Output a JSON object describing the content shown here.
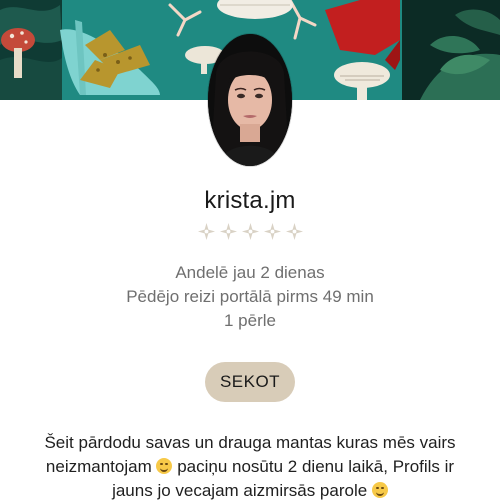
{
  "profile": {
    "username": "krista.jm",
    "rating": {
      "filled": 0,
      "max": 5,
      "star_color": "#d9d2c5"
    },
    "meta": {
      "member_since": "Andelē jau 2 dienas",
      "last_seen": "Pēdējo reizi portālā pirms 49 min",
      "pearls": "1 pērle"
    },
    "follow_label": "SEKOT",
    "bio": {
      "line1": "Šeit pārdodu savas un drauga mantas kuras mēs vairs",
      "line2a": "neizmantojam",
      "line2b": "paciņu nosūtu 2 dienu laikā, Profils ir",
      "line3": "jauns jo vecajam aizmirsās parole"
    }
  },
  "theme": {
    "banner_teal": "#1f8a82",
    "follow_button_bg": "#d8ccb8",
    "meta_text": "#6f6f6f"
  },
  "icons": [
    "profile-avatar",
    "rating-star-icon",
    "smiling-emoji-icon",
    "pensive-emoji-icon"
  ]
}
